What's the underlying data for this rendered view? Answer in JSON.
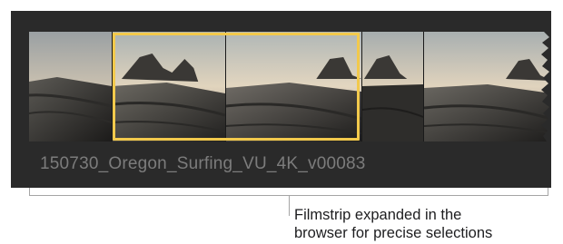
{
  "browser": {
    "clip_name": "150730_Oregon_Surfing_VU_4K_v00083",
    "frame_count": 5,
    "selection_color": "#f2c94c",
    "background_color": "#2a2a2a"
  },
  "callout": {
    "line1": "Filmstrip expanded in the",
    "line2": "browser for precise selections"
  }
}
